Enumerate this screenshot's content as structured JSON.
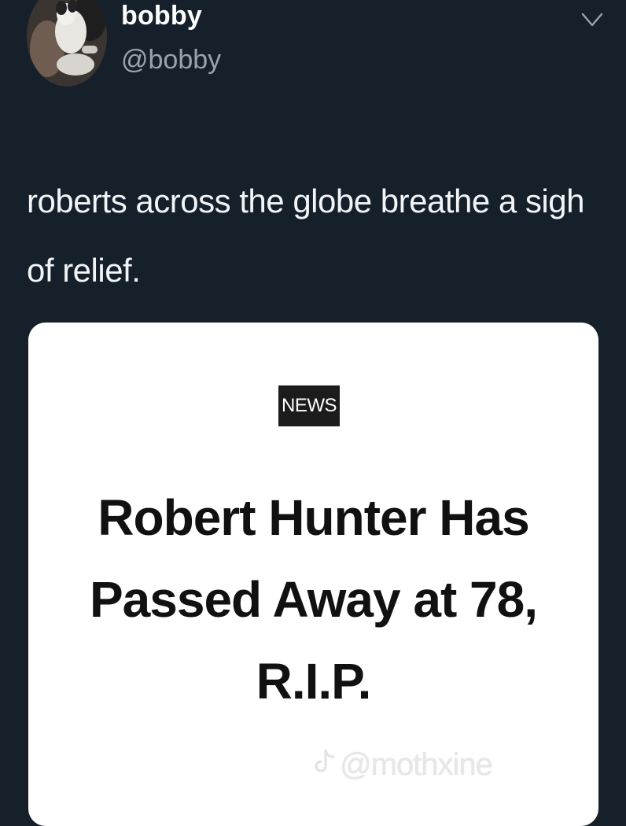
{
  "tweet": {
    "display_name": "bobby",
    "handle": "@bobby",
    "text": "roberts across the globe breathe a sigh of relief."
  },
  "card": {
    "badge": "NEWS",
    "headline_lines": [
      "Robert Hunter Has",
      "Passed Away at 78,",
      "R.I.P."
    ]
  },
  "watermark": {
    "handle": "@mothxine"
  },
  "icons": {
    "avatar": "avatar-dog-photo",
    "menu": "chevron-down-icon",
    "watermark_logo": "tiktok-icon"
  },
  "colors": {
    "background": "#15202b",
    "card": "#ffffff",
    "badge": "#1c1c1c",
    "secondary_text": "#9aa3ad"
  }
}
